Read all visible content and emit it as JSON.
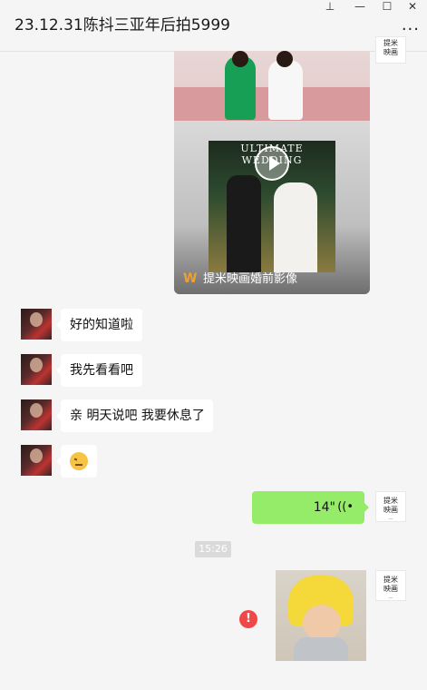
{
  "window": {
    "title": "23.12.31陈抖三亚年后拍5999",
    "pin_icon": "pin-icon",
    "minimize_icon": "minimize-icon",
    "maximize_icon": "maximize-icon",
    "close_icon": "close-icon",
    "more_label": "···"
  },
  "contact": {
    "brand_line1": "提米",
    "brand_line2": "映画",
    "brand_sub": "—"
  },
  "messages": {
    "card_title": "提米映画婚前影像",
    "card_poster_text": "ULTIMATE WEDDING",
    "msg1": "好的知道啦",
    "msg2": "我先看看吧",
    "msg3": "亲 明天说吧 我要休息了",
    "emoji": "angry-face-emoji",
    "voice_duration": "14\"",
    "voice_icon": "((•",
    "timestamp": "15:26",
    "error_mark": "!"
  },
  "colors": {
    "sent_bubble": "#95ec69",
    "received_bubble": "#ffffff",
    "background": "#f5f5f5",
    "error": "#f04848"
  }
}
